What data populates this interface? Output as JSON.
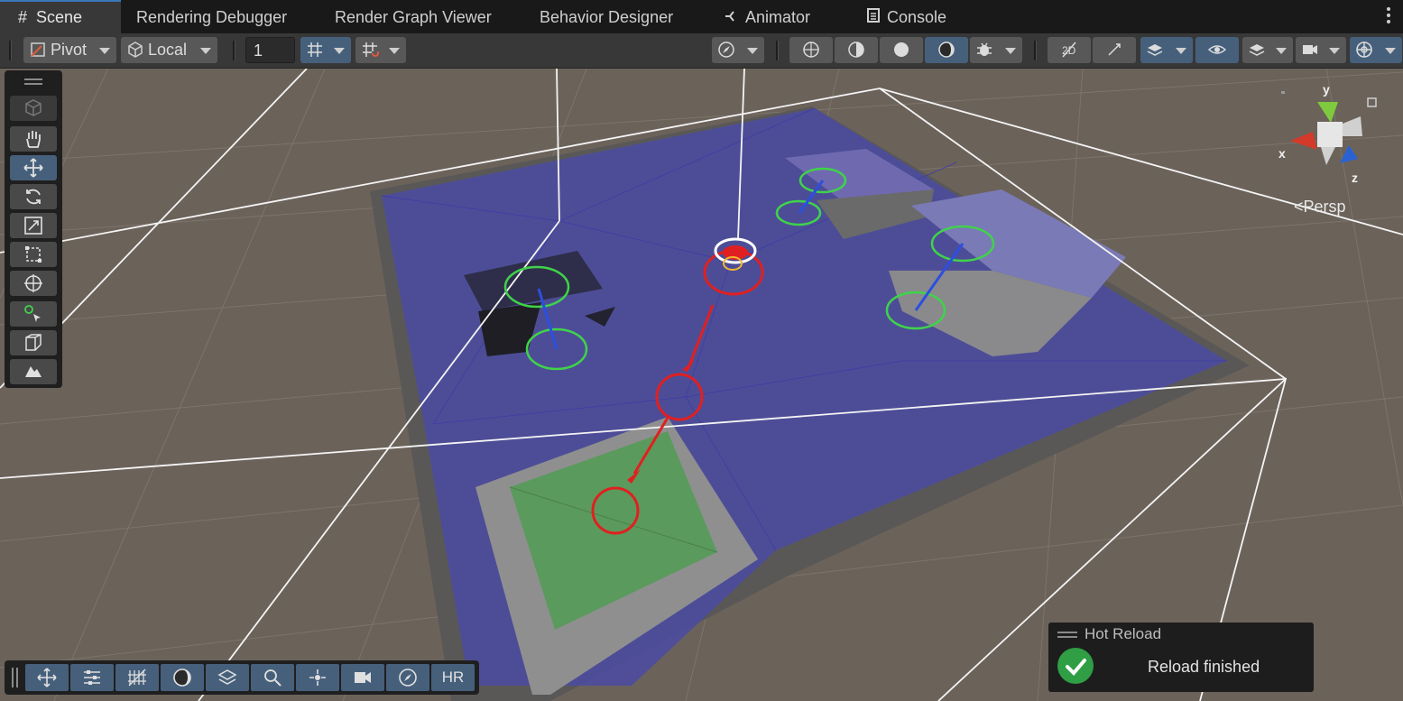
{
  "tabs": [
    {
      "label": "Scene",
      "icon": "grid-hash-icon",
      "active": true
    },
    {
      "label": "Rendering Debugger",
      "icon": "",
      "active": false
    },
    {
      "label": "Render Graph Viewer",
      "icon": "",
      "active": false
    },
    {
      "label": "Behavior Designer",
      "icon": "",
      "active": false
    },
    {
      "label": "Animator",
      "icon": "animator-icon",
      "active": false
    },
    {
      "label": "Console",
      "icon": "console-icon",
      "active": false
    }
  ],
  "toolbar": {
    "pivot_label": "Pivot",
    "local_label": "Local",
    "grid_snap_value": "1"
  },
  "viewport": {
    "projection_label": "Persp",
    "axis_x": "x",
    "axis_y": "y",
    "axis_z": "z"
  },
  "bottom_overlay": {
    "hr_label": "HR"
  },
  "hot_reload": {
    "title": "Hot Reload",
    "message": "Reload finished"
  },
  "colors": {
    "accent_blue": "#46607c",
    "navmesh": "#4a4aa6",
    "path_red": "#e02020",
    "success_green": "#2f9e44"
  }
}
